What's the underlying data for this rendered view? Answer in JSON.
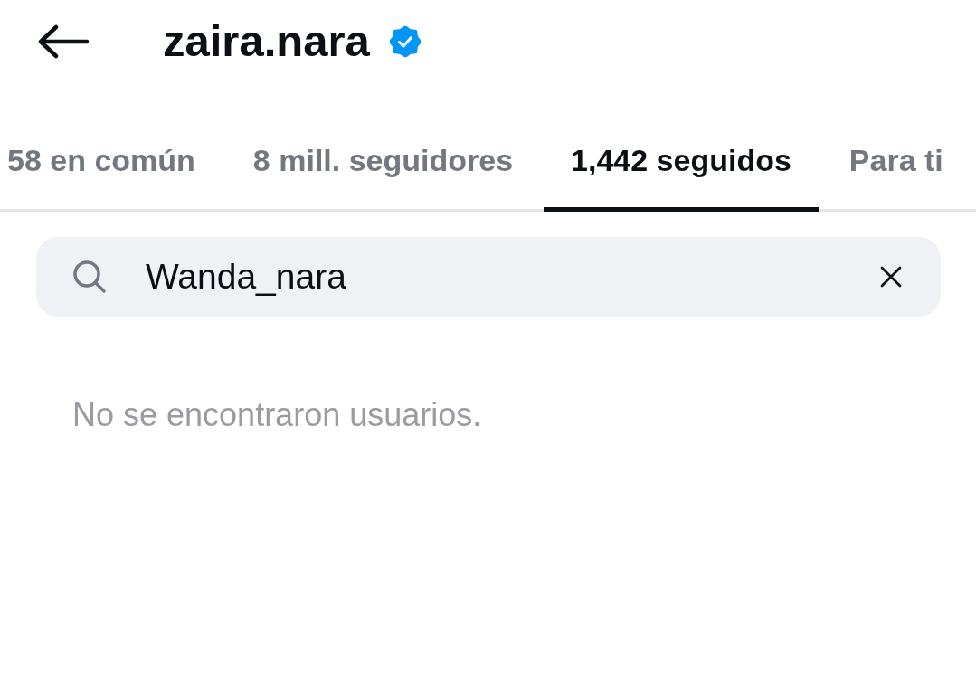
{
  "header": {
    "title": "zaira.nara",
    "verified": true
  },
  "tabs": [
    {
      "label": "58 en común",
      "selected": false
    },
    {
      "label": "8 mill. seguidores",
      "selected": false
    },
    {
      "label": "1,442 seguidos",
      "selected": true
    },
    {
      "label": "Para ti",
      "selected": false
    }
  ],
  "search": {
    "value": "Wanda_nara"
  },
  "results": {
    "empty_message": "No se encontraron usuarios."
  }
}
